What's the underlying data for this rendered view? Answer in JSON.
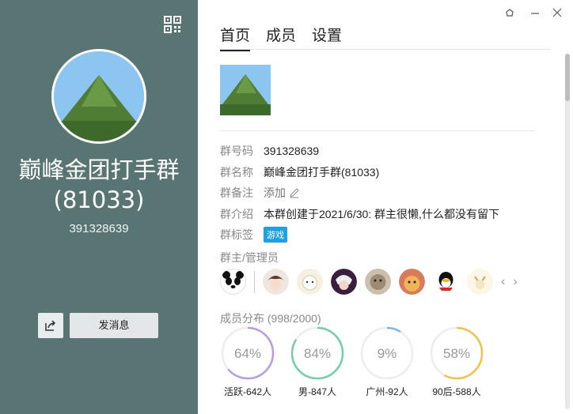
{
  "group": {
    "name_line1": "巅峰金团打手群",
    "name_line2": "(81033)",
    "number": "391328639"
  },
  "left_actions": {
    "send_message": "发消息"
  },
  "tabs": [
    {
      "label": "首页"
    },
    {
      "label": "成员"
    },
    {
      "label": "设置"
    }
  ],
  "info": {
    "number_label": "群号码",
    "number_value": "391328639",
    "name_label": "群名称",
    "name_value": "巅峰金团打手群(81033)",
    "remark_label": "群备注",
    "remark_value": "添加",
    "intro_label": "群介绍",
    "intro_value": "本群创建于2021/6/30:  群主很懒,什么都没有留下",
    "tags_label": "群标签",
    "tag_value": "游戏"
  },
  "admins": {
    "title": "群主/管理员"
  },
  "distribution": {
    "title": "成员分布",
    "count": "(998/2000)",
    "items": [
      {
        "pct": "64%",
        "value": 0.64,
        "caption": "活跃-642人",
        "color": "#b89ce0"
      },
      {
        "pct": "84%",
        "value": 0.84,
        "caption": "男-847人",
        "color": "#6fd0a8"
      },
      {
        "pct": "9%",
        "value": 0.09,
        "caption": "广州-92人",
        "color": "#7eb6ee"
      },
      {
        "pct": "58%",
        "value": 0.58,
        "caption": "90后-588人",
        "color": "#f5c04a"
      }
    ]
  },
  "colors": {
    "left_panel": "#587573",
    "tag": "#1aa1e6"
  },
  "icons": {
    "qr": "qr-code-icon",
    "share": "share-icon",
    "edit": "pencil-icon"
  }
}
